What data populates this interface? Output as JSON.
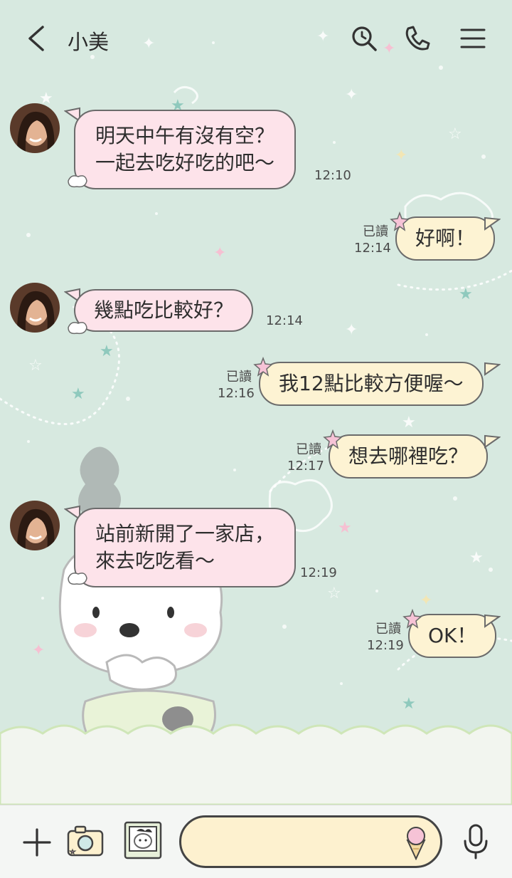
{
  "header": {
    "contact_name": "小美",
    "icons": [
      "back-arrow-icon",
      "search-icon",
      "phone-icon",
      "menu-icon"
    ]
  },
  "messages": [
    {
      "direction": "in",
      "lines": [
        "明天中午有沒有空？",
        "一起去吃好吃的吧～"
      ],
      "time": "12:10"
    },
    {
      "direction": "out",
      "text": "好啊！",
      "time": "12:14",
      "read": "已讀"
    },
    {
      "direction": "in",
      "lines": [
        "幾點吃比較好？"
      ],
      "time": "12:14"
    },
    {
      "direction": "out",
      "text": "我12點比較方便喔～",
      "time": "12:16",
      "read": "已讀"
    },
    {
      "direction": "out",
      "text": "想去哪裡吃？",
      "time": "12:17",
      "read": "已讀"
    },
    {
      "direction": "in",
      "lines": [
        "站前新開了一家店，",
        "來去吃吃看～"
      ],
      "time": "12:19"
    },
    {
      "direction": "out",
      "text": "OK！",
      "time": "12:19",
      "read": "已讀"
    }
  ],
  "composer": {
    "placeholder": "",
    "icons": [
      "plus-icon",
      "camera-icon",
      "photo-icon",
      "ice-cream-icon",
      "microphone-icon"
    ]
  },
  "colors": {
    "background": "#d7e9e0",
    "incoming_bubble": "#fde3ea",
    "outgoing_bubble": "#fdf3d3",
    "input_field": "#fdf1cf"
  }
}
